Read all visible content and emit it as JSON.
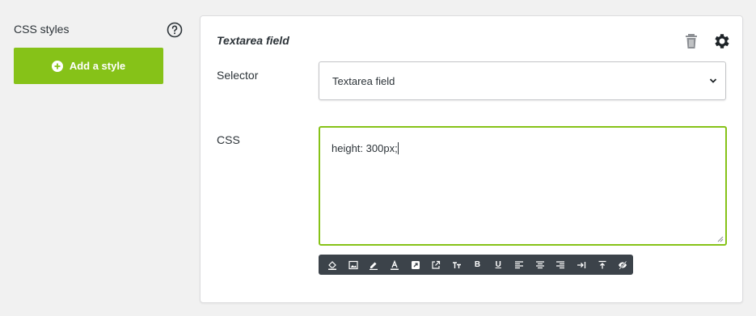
{
  "sidebar": {
    "title": "CSS styles",
    "add_button_label": "Add a style"
  },
  "panel": {
    "title": "Textarea field",
    "selector_label": "Selector",
    "selector_value": "Textarea field",
    "css_label": "CSS",
    "css_value": "height: 300px;"
  },
  "toolbar": {
    "bold_label": "B",
    "underline_label": "U"
  },
  "colors": {
    "accent": "#86c218",
    "toolbar_bg": "#3c434a"
  },
  "icons": [
    "question-circle-icon",
    "plus-circle-icon",
    "trash-icon",
    "gear-icon",
    "chevron-down-icon",
    "fill-color-icon",
    "image-icon",
    "pen-icon",
    "text-color-icon",
    "link-square-icon",
    "external-link-icon",
    "font-size-icon",
    "bold-icon",
    "underline-icon",
    "align-left-icon",
    "align-center-icon",
    "align-right-icon",
    "indent-icon",
    "align-top-icon",
    "hide-icon"
  ]
}
